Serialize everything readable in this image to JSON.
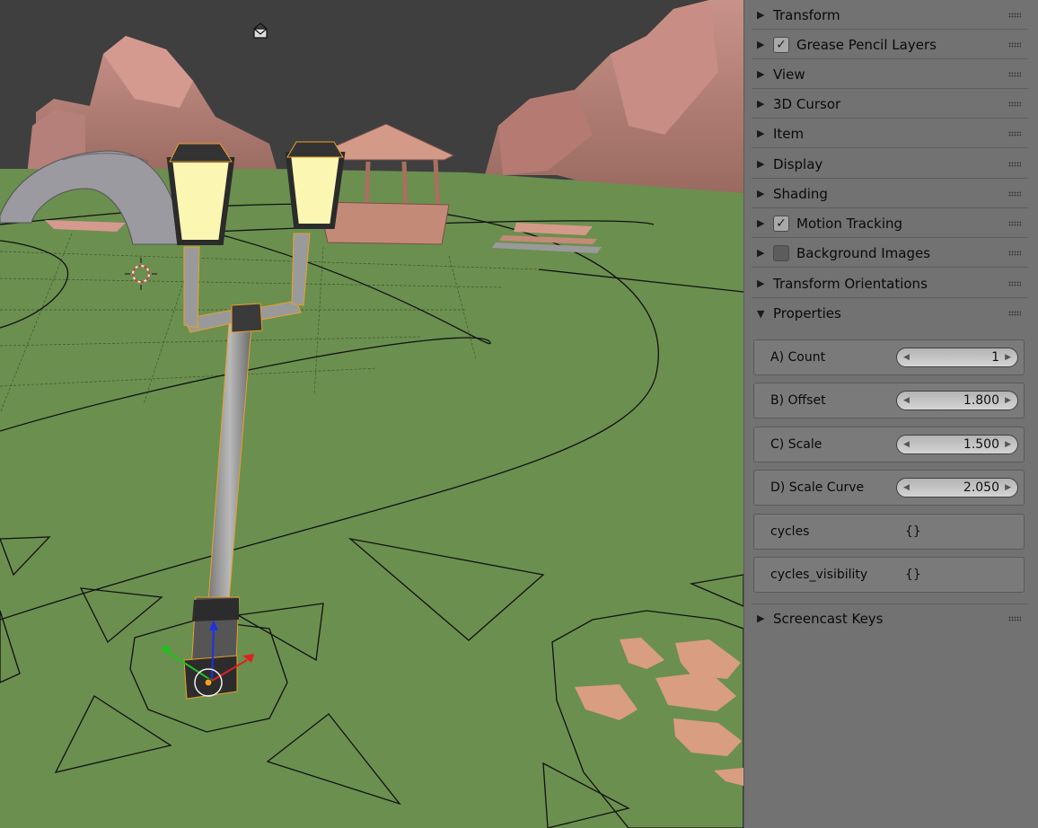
{
  "colors": {
    "sky": "#3f3f3f",
    "ground": "#6b8f4f",
    "rock": "#b07a6e",
    "panel_bg": "#727272",
    "field_bg": "#c4c4c4",
    "selection_outline": "#e8a02a",
    "lamp_glass": "#fbf6b2"
  },
  "panels": {
    "transform": {
      "label": "Transform",
      "expanded": false
    },
    "grease_pencil": {
      "label": "Grease Pencil Layers",
      "expanded": false,
      "checked": true
    },
    "view": {
      "label": "View",
      "expanded": false
    },
    "cursor": {
      "label": "3D Cursor",
      "expanded": false
    },
    "item": {
      "label": "Item",
      "expanded": false
    },
    "display": {
      "label": "Display",
      "expanded": false
    },
    "shading": {
      "label": "Shading",
      "expanded": false
    },
    "motion_tracking": {
      "label": "Motion Tracking",
      "expanded": false,
      "checked": true
    },
    "background_images": {
      "label": "Background Images",
      "expanded": false,
      "checked": false
    },
    "transform_orientations": {
      "label": "Transform Orientations",
      "expanded": false
    },
    "properties": {
      "label": "Properties",
      "expanded": true
    },
    "screencast_keys": {
      "label": "Screencast Keys",
      "expanded": false
    }
  },
  "arrows": {
    "collapsed": "▶",
    "expanded": "▼",
    "left": "◀",
    "right": "▶",
    "check": "✓"
  },
  "properties": {
    "count": {
      "label": "A) Count",
      "value": "1"
    },
    "offset": {
      "label": "B) Offset",
      "value": "1.800"
    },
    "scale": {
      "label": "C) Scale",
      "value": "1.500"
    },
    "scale_curve": {
      "label": "D) Scale Curve",
      "value": "2.050"
    },
    "cycles": {
      "label": "cycles",
      "value": "{}"
    },
    "cycles_visibility": {
      "label": "cycles_visibility",
      "value": "{}"
    }
  },
  "viewport": {
    "icons": [
      "envelope-icon",
      "3d-cursor-icon",
      "transform-gizmo-icon"
    ]
  }
}
